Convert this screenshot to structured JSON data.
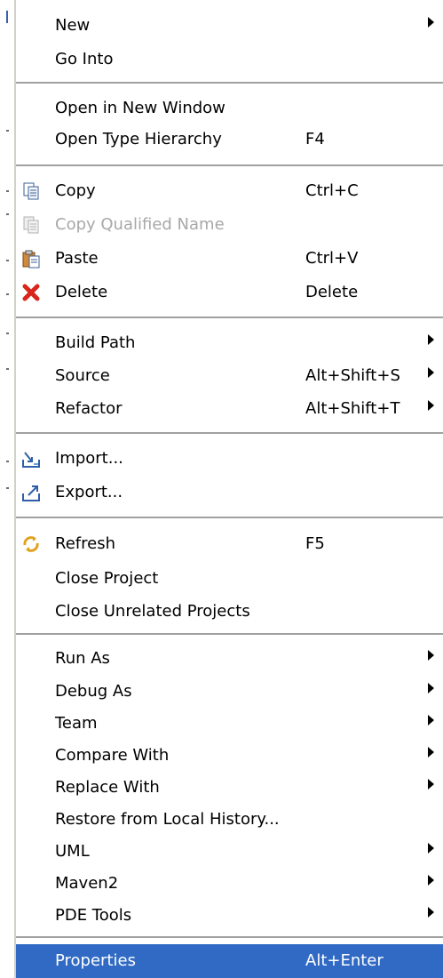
{
  "menu": {
    "items": [
      {
        "label": "New",
        "accel": "",
        "submenu": true
      },
      {
        "label": "Go Into",
        "accel": "",
        "submenu": false
      },
      {
        "label": "Open in New Window",
        "accel": "",
        "submenu": false
      },
      {
        "label": "Open Type Hierarchy",
        "accel": "F4",
        "submenu": false
      },
      {
        "label": "Copy",
        "accel": "Ctrl+C",
        "submenu": false,
        "icon": "copy-icon"
      },
      {
        "label": "Copy Qualified Name",
        "accel": "",
        "submenu": false,
        "icon": "copy-qualified-name-icon",
        "disabled": true
      },
      {
        "label": "Paste",
        "accel": "Ctrl+V",
        "submenu": false,
        "icon": "paste-icon"
      },
      {
        "label": "Delete",
        "accel": "Delete",
        "submenu": false,
        "icon": "delete-icon"
      },
      {
        "label": "Build Path",
        "accel": "",
        "submenu": true
      },
      {
        "label": "Source",
        "accel": "Alt+Shift+S",
        "submenu": true
      },
      {
        "label": "Refactor",
        "accel": "Alt+Shift+T",
        "submenu": true
      },
      {
        "label": "Import...",
        "accel": "",
        "submenu": false,
        "icon": "import-icon"
      },
      {
        "label": "Export...",
        "accel": "",
        "submenu": false,
        "icon": "export-icon"
      },
      {
        "label": "Refresh",
        "accel": "F5",
        "submenu": false,
        "icon": "refresh-icon"
      },
      {
        "label": "Close Project",
        "accel": "",
        "submenu": false
      },
      {
        "label": "Close Unrelated Projects",
        "accel": "",
        "submenu": false
      },
      {
        "label": "Run As",
        "accel": "",
        "submenu": true
      },
      {
        "label": "Debug As",
        "accel": "",
        "submenu": true
      },
      {
        "label": "Team",
        "accel": "",
        "submenu": true
      },
      {
        "label": "Compare With",
        "accel": "",
        "submenu": true
      },
      {
        "label": "Replace With",
        "accel": "",
        "submenu": true
      },
      {
        "label": "Restore from Local History...",
        "accel": "",
        "submenu": false
      },
      {
        "label": "UML",
        "accel": "",
        "submenu": true
      },
      {
        "label": "Maven2",
        "accel": "",
        "submenu": true
      },
      {
        "label": "PDE Tools",
        "accel": "",
        "submenu": true
      },
      {
        "label": "Properties",
        "accel": "Alt+Enter",
        "submenu": false,
        "selected": true
      }
    ]
  },
  "colors": {
    "selection": "#316ac5",
    "separator": "#a0a0a0",
    "disabled_text": "#a8a8a8"
  }
}
